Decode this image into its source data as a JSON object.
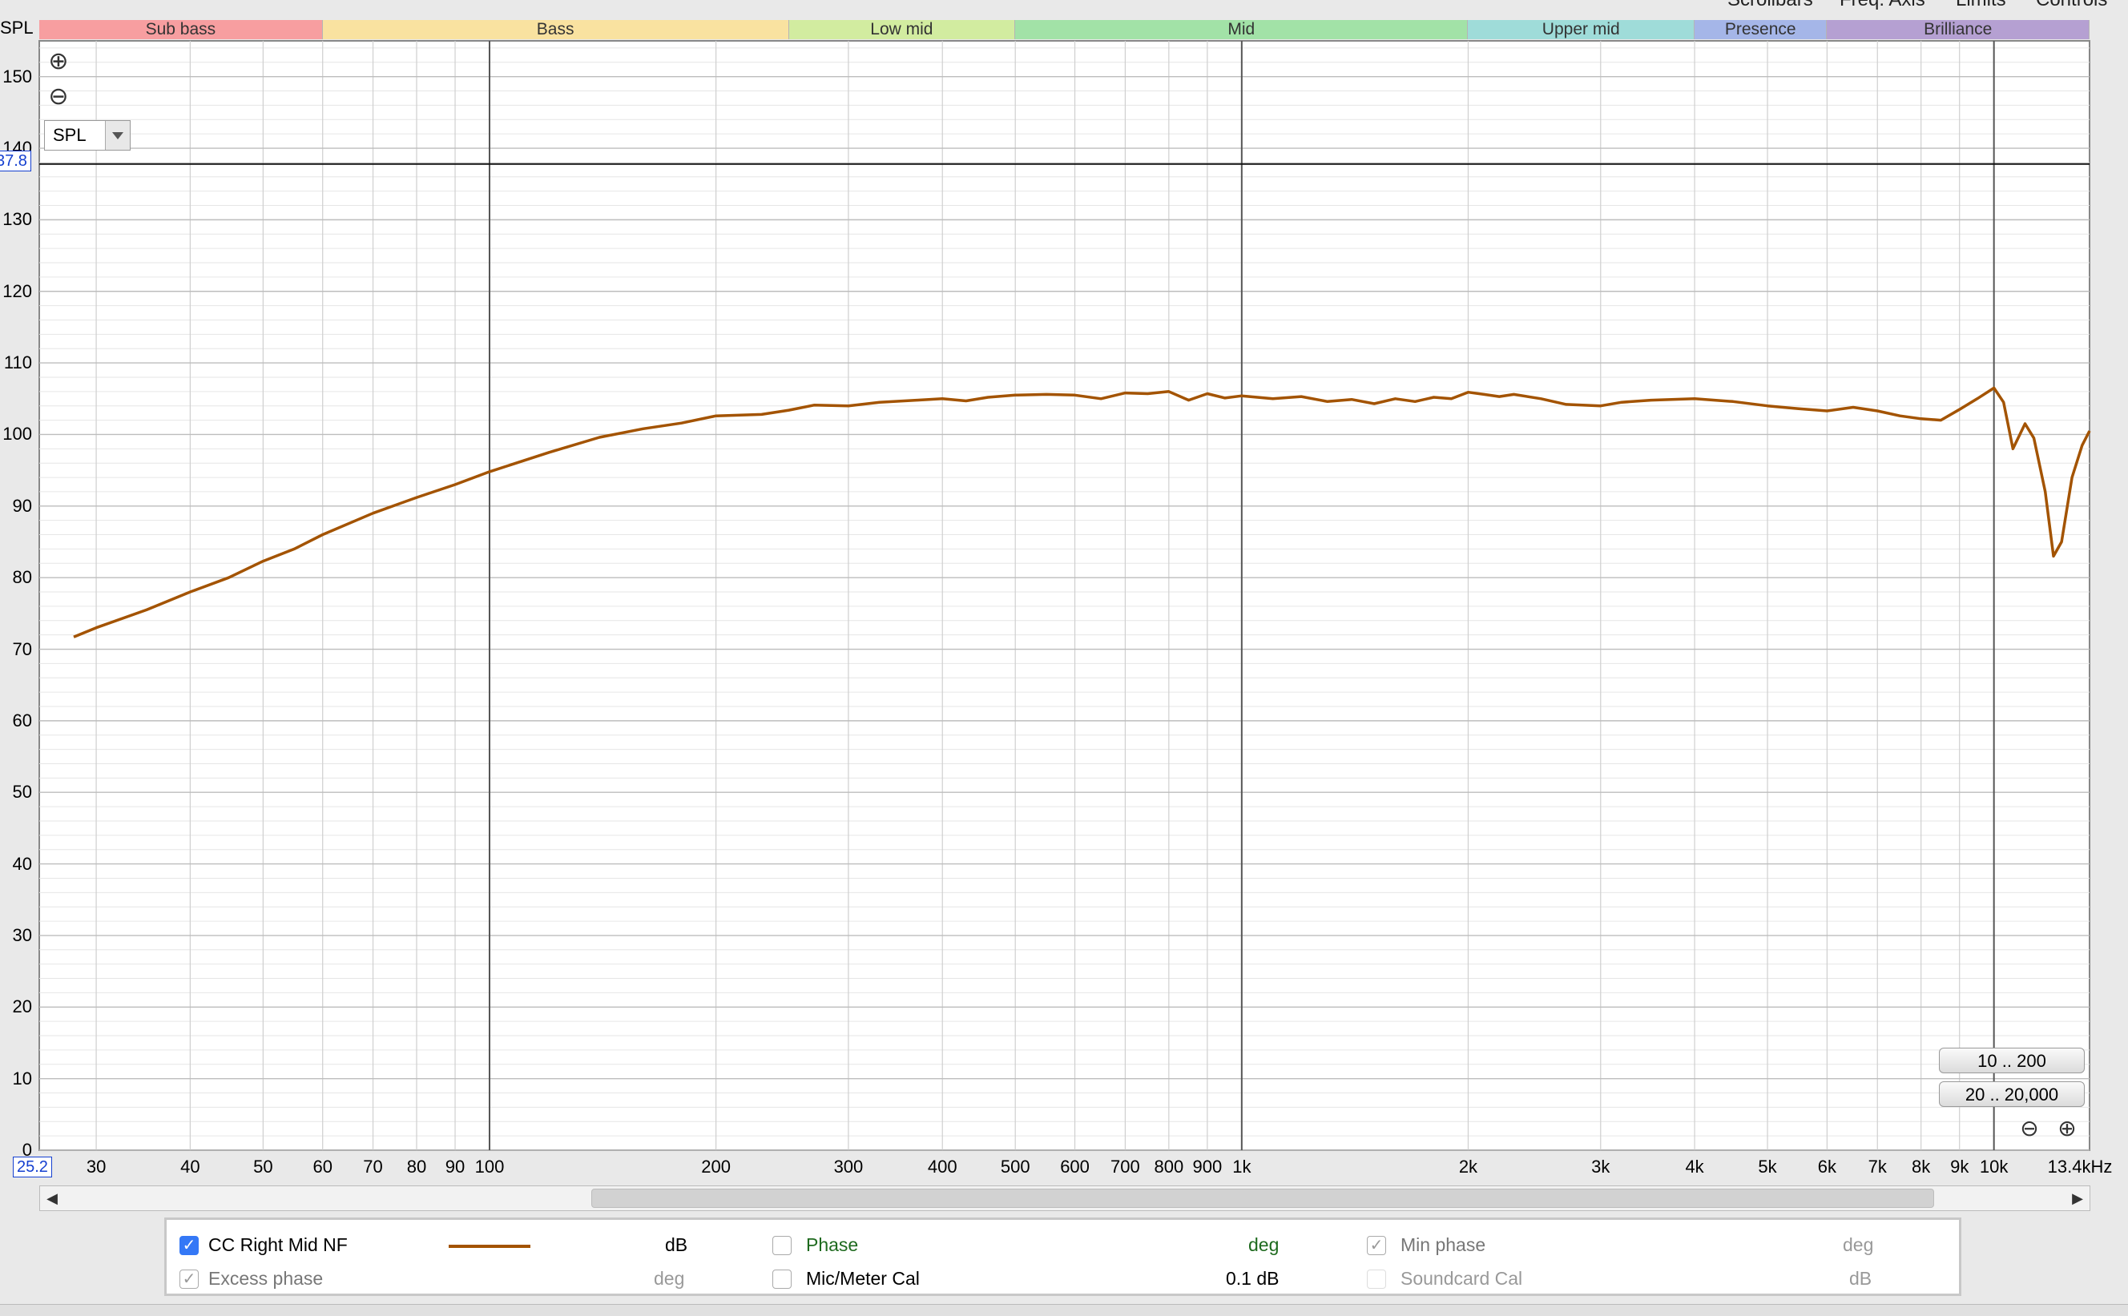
{
  "top_menu": [
    "Scrollbars",
    "Freq. Axis",
    "Limits",
    "Controls"
  ],
  "bands": [
    {
      "label": "Sub bass",
      "from": 10,
      "to": 60,
      "color": "#f79ea0"
    },
    {
      "label": "Bass",
      "from": 60,
      "to": 250,
      "color": "#f9e2a0"
    },
    {
      "label": "Low mid",
      "from": 250,
      "to": 500,
      "color": "#d2eca0"
    },
    {
      "label": "Mid",
      "from": 500,
      "to": 2000,
      "color": "#a2e2a7"
    },
    {
      "label": "Upper mid",
      "from": 2000,
      "to": 4000,
      "color": "#9fdcd9"
    },
    {
      "label": "Presence",
      "from": 4000,
      "to": 6000,
      "color": "#a5b6e8"
    },
    {
      "label": "Brilliance",
      "from": 6000,
      "to": 20000,
      "color": "#b5a0d2"
    }
  ],
  "spl_select": {
    "value": "SPL"
  },
  "y_axis_title": "SPL",
  "cursor": {
    "y_value_label": "37.8",
    "y_value": 137.8,
    "x_value_label": "25.2"
  },
  "chart_data": {
    "type": "line",
    "x_scale": "log",
    "xlim": [
      25.2,
      13400
    ],
    "ylim": [
      0,
      155
    ],
    "y_ticks": [
      0,
      10,
      20,
      30,
      40,
      50,
      60,
      70,
      80,
      90,
      100,
      110,
      120,
      130,
      140,
      150
    ],
    "x_ticks": [
      {
        "v": 30,
        "l": "30"
      },
      {
        "v": 40,
        "l": "40"
      },
      {
        "v": 50,
        "l": "50"
      },
      {
        "v": 60,
        "l": "60"
      },
      {
        "v": 70,
        "l": "70"
      },
      {
        "v": 80,
        "l": "80"
      },
      {
        "v": 90,
        "l": "90"
      },
      {
        "v": 100,
        "l": "100"
      },
      {
        "v": 200,
        "l": "200"
      },
      {
        "v": 300,
        "l": "300"
      },
      {
        "v": 400,
        "l": "400"
      },
      {
        "v": 500,
        "l": "500"
      },
      {
        "v": 600,
        "l": "600"
      },
      {
        "v": 700,
        "l": "700"
      },
      {
        "v": 800,
        "l": "800"
      },
      {
        "v": 900,
        "l": "900"
      },
      {
        "v": 1000,
        "l": "1k"
      },
      {
        "v": 2000,
        "l": "2k"
      },
      {
        "v": 3000,
        "l": "3k"
      },
      {
        "v": 4000,
        "l": "4k"
      },
      {
        "v": 5000,
        "l": "5k"
      },
      {
        "v": 6000,
        "l": "6k"
      },
      {
        "v": 7000,
        "l": "7k"
      },
      {
        "v": 8000,
        "l": "8k"
      },
      {
        "v": 9000,
        "l": "9k"
      },
      {
        "v": 10000,
        "l": "10k"
      },
      {
        "v": 13400,
        "l": "13.4kHz"
      }
    ],
    "grid": true,
    "series": [
      {
        "name": "CC Right Mid NF",
        "color": "#a35300",
        "points": [
          [
            28,
            71.7
          ],
          [
            30,
            73
          ],
          [
            35,
            75.5
          ],
          [
            40,
            78
          ],
          [
            45,
            80
          ],
          [
            50,
            82.3
          ],
          [
            55,
            84
          ],
          [
            60,
            86
          ],
          [
            70,
            89
          ],
          [
            80,
            91.2
          ],
          [
            90,
            93
          ],
          [
            100,
            94.8
          ],
          [
            120,
            97.5
          ],
          [
            140,
            99.6
          ],
          [
            160,
            100.8
          ],
          [
            180,
            101.6
          ],
          [
            200,
            102.6
          ],
          [
            230,
            102.8
          ],
          [
            250,
            103.4
          ],
          [
            270,
            104.1
          ],
          [
            300,
            104.0
          ],
          [
            330,
            104.5
          ],
          [
            370,
            104.8
          ],
          [
            400,
            105.0
          ],
          [
            430,
            104.7
          ],
          [
            460,
            105.2
          ],
          [
            500,
            105.5
          ],
          [
            550,
            105.6
          ],
          [
            600,
            105.5
          ],
          [
            650,
            105.0
          ],
          [
            700,
            105.8
          ],
          [
            750,
            105.7
          ],
          [
            800,
            106.0
          ],
          [
            850,
            104.8
          ],
          [
            900,
            105.7
          ],
          [
            950,
            105.1
          ],
          [
            1000,
            105.4
          ],
          [
            1100,
            105.0
          ],
          [
            1200,
            105.3
          ],
          [
            1300,
            104.6
          ],
          [
            1400,
            104.9
          ],
          [
            1500,
            104.3
          ],
          [
            1600,
            105.0
          ],
          [
            1700,
            104.6
          ],
          [
            1800,
            105.2
          ],
          [
            1900,
            105.0
          ],
          [
            2000,
            105.9
          ],
          [
            2100,
            105.6
          ],
          [
            2200,
            105.3
          ],
          [
            2300,
            105.6
          ],
          [
            2500,
            105.0
          ],
          [
            2700,
            104.2
          ],
          [
            3000,
            104.0
          ],
          [
            3200,
            104.5
          ],
          [
            3500,
            104.8
          ],
          [
            4000,
            105.0
          ],
          [
            4500,
            104.6
          ],
          [
            5000,
            104.0
          ],
          [
            5500,
            103.6
          ],
          [
            6000,
            103.3
          ],
          [
            6500,
            103.8
          ],
          [
            7000,
            103.3
          ],
          [
            7500,
            102.6
          ],
          [
            8000,
            102.2
          ],
          [
            8500,
            102.0
          ],
          [
            9000,
            103.5
          ],
          [
            9500,
            105.0
          ],
          [
            10000,
            106.5
          ],
          [
            10300,
            104.5
          ],
          [
            10600,
            98.0
          ],
          [
            11000,
            101.5
          ],
          [
            11300,
            99.5
          ],
          [
            11700,
            92.0
          ],
          [
            12000,
            83.0
          ],
          [
            12300,
            85.0
          ],
          [
            12700,
            94.0
          ],
          [
            13100,
            98.5
          ],
          [
            13400,
            100.5
          ]
        ]
      }
    ]
  },
  "range_buttons": [
    "10 .. 200",
    "20 .. 20,000"
  ],
  "legend": {
    "trace_name": "CC Right Mid NF",
    "trace_unit": "dB",
    "trace_color": "#a35300",
    "phase_label": "Phase",
    "phase_unit": "deg",
    "min_phase_label": "Min phase",
    "min_phase_unit": "deg",
    "excess_phase_label": "Excess phase",
    "excess_phase_unit": "deg",
    "mic_cal_label": "Mic/Meter Cal",
    "mic_cal_value": "0.1 dB",
    "soundcard_cal_label": "Soundcard Cal",
    "soundcard_cal_unit": "dB",
    "check_glyph": "✓"
  },
  "icons": {
    "zoom_in": "⊕",
    "zoom_out": "⊖",
    "scroll_left": "◀",
    "scroll_right": "▶"
  }
}
